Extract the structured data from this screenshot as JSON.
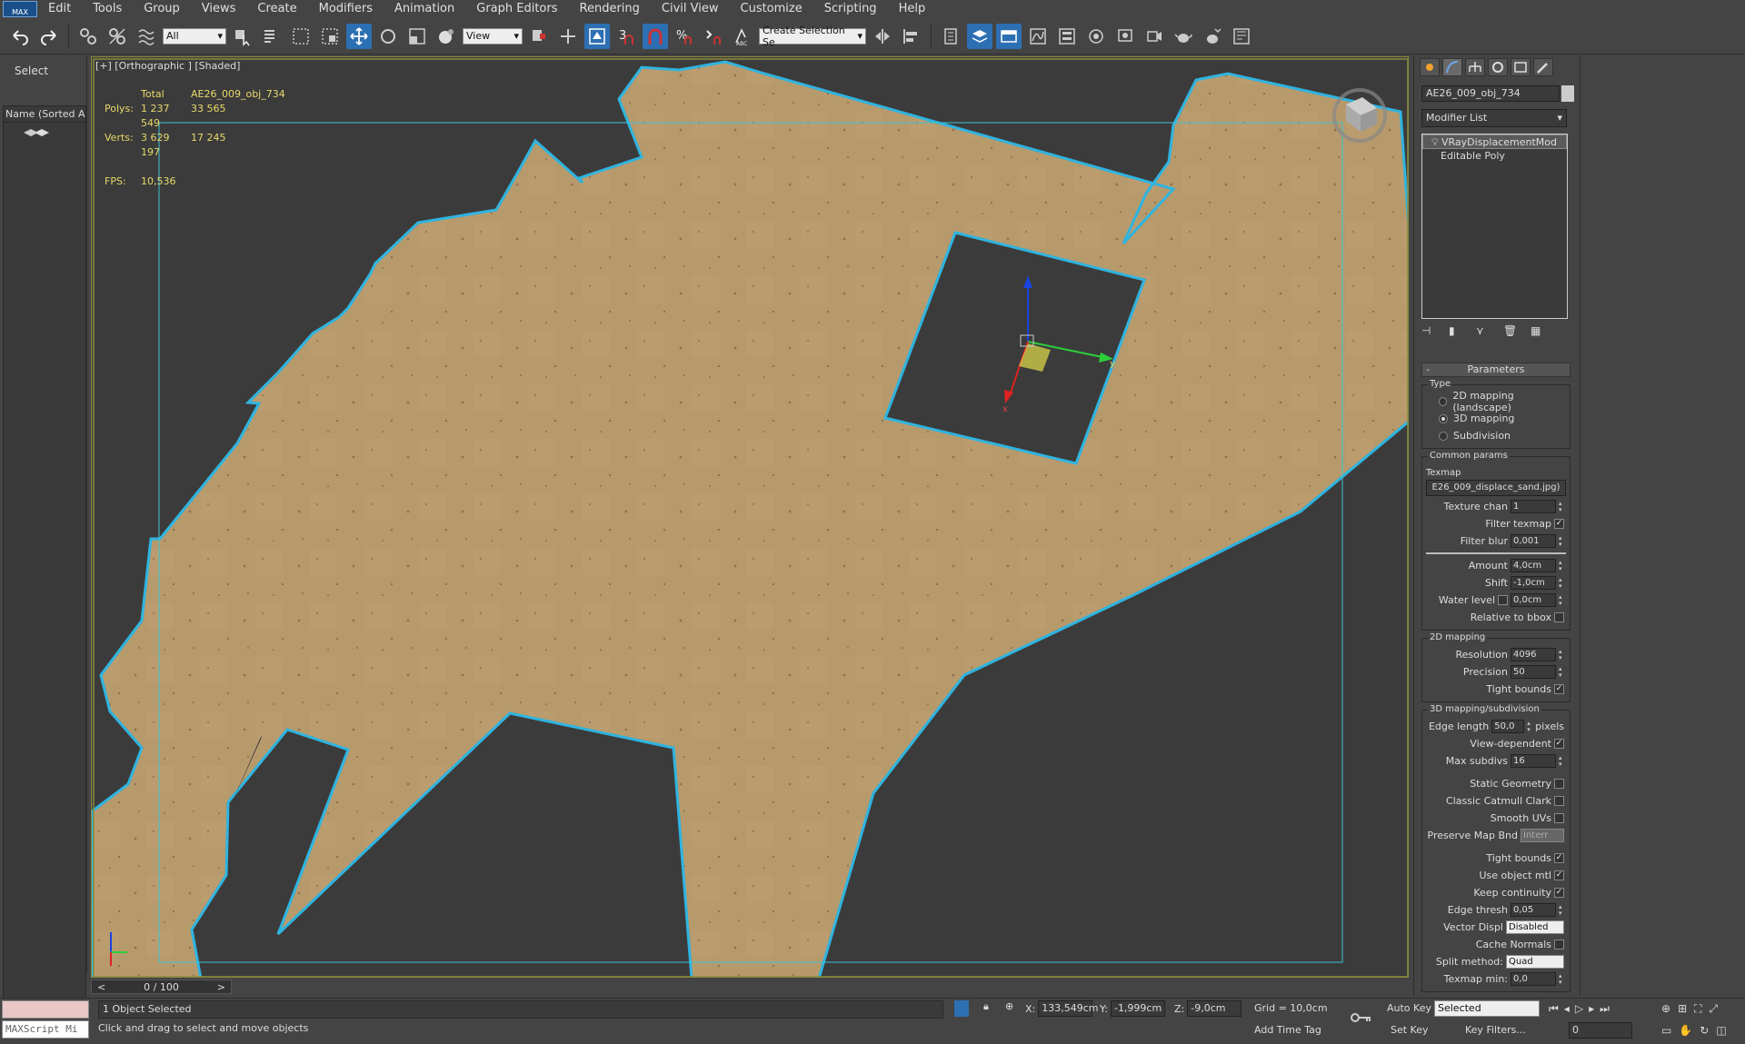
{
  "menu": [
    "Edit",
    "Tools",
    "Group",
    "Views",
    "Create",
    "Modifiers",
    "Animation",
    "Graph Editors",
    "Rendering",
    "Civil View",
    "Customize",
    "Scripting",
    "Help"
  ],
  "app_logo": "MAX",
  "toolbar": {
    "filter_value": "All",
    "coord_value": "View",
    "selection_set_placeholder": "Create Selection Se"
  },
  "left": {
    "select_label": "Select",
    "scene_header": "Name (Sorted Asc"
  },
  "viewport": {
    "label": "[+] [Orthographic ] [Shaded]",
    "stats": {
      "total_label": "Total",
      "object_name": "AE26_009_obj_734",
      "polys_label": "Polys:",
      "polys_total": "1 237 549",
      "polys_obj": "33 565",
      "verts_label": "Verts:",
      "verts_total": "3 629 197",
      "verts_obj": "17 245",
      "fps_label": "FPS:",
      "fps_value": "10,536"
    }
  },
  "timeslider": {
    "value": "0 / 100"
  },
  "status": {
    "maxscript_placeholder": "MAXScript Mi",
    "selected": "1 Object Selected",
    "message": "Click and drag to select and move objects",
    "x_label": "X:",
    "x": "133,549cm",
    "y_label": "Y:",
    "y": "-1,999cm",
    "z_label": "Z:",
    "z": "-9,0cm",
    "grid": "Grid = 10,0cm",
    "add_time_tag": "Add Time Tag",
    "auto_key": "Auto Key",
    "set_key": "Set Key",
    "selected_dropdown": "Selected",
    "key_filters": "Key Filters...",
    "frame": "0"
  },
  "command_panel": {
    "object_name": "AE26_009_obj_734",
    "modifier_list": "Modifier List",
    "stack": [
      "VRayDisplacementMod",
      "Editable Poly"
    ],
    "parameters_title": "Parameters",
    "type_group": "Type",
    "type_options": [
      "2D mapping (landscape)",
      "3D mapping",
      "Subdivision"
    ],
    "common_group": "Common params",
    "texmap_label": "Texmap",
    "texmap_value": "E26_009_displace_sand.jpg)",
    "texture_chan_label": "Texture chan",
    "texture_chan": "1",
    "filter_texmap_label": "Filter texmap",
    "filter_blur_label": "Filter blur",
    "filter_blur": "0,001",
    "amount_label": "Amount",
    "amount": "4,0cm",
    "shift_label": "Shift",
    "shift": "-1,0cm",
    "water_label": "Water level",
    "water": "0,0cm",
    "relative_bbox_label": "Relative to bbox",
    "mapping2d_group": "2D mapping",
    "resolution_label": "Resolution",
    "resolution": "4096",
    "precision_label": "Precision",
    "precision": "50",
    "tight_bounds_label": "Tight bounds",
    "mapping3d_group": "3D mapping/subdivision",
    "edge_length_label": "Edge length",
    "edge_length": "50,0",
    "pixels_label": "pixels",
    "view_dependent_label": "View-dependent",
    "max_subdivs_label": "Max subdivs",
    "max_subdivs": "16",
    "static_geometry_label": "Static Geometry",
    "classic_catmull_label": "Classic Catmull Clark",
    "smooth_uvs_label": "Smooth UVs",
    "preserve_map_label": "Preserve Map Bnd",
    "preserve_map_value": "Interr",
    "tight_bounds2_label": "Tight bounds",
    "use_object_mtl_label": "Use object mtl",
    "keep_continuity_label": "Keep continuity",
    "edge_thresh_label": "Edge thresh",
    "edge_thresh": "0,05",
    "vector_displ_label": "Vector Displ",
    "vector_displ": "Disabled",
    "cache_normals_label": "Cache Normals",
    "split_method_label": "Split method:",
    "split_method": "Quad",
    "texmap_min_label": "Texmap min:",
    "texmap_min": "0,0"
  },
  "colors": {
    "selection_outline": "#2fb4e0",
    "sand": "#b99a6b",
    "viewport_bg": "#3b3b3b",
    "accent": "#2d6fb3"
  }
}
